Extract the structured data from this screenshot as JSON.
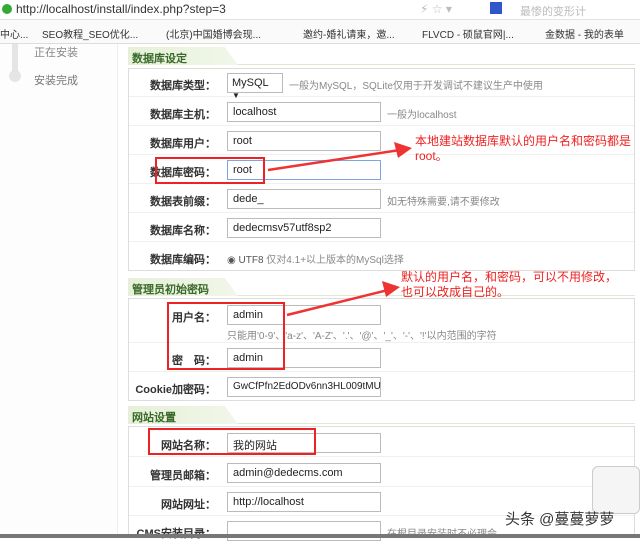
{
  "browser": {
    "url": "http://localhost/install/index.php?step=3",
    "search_placeholder": "最惨的变形计",
    "bookmarks": [
      "中心...",
      "SEO教程_SEO优化...",
      "(北京)中国婚博会现...",
      "邀约-婚礼请柬，邀...",
      "FLVCD - 硕鼠官网|...",
      "金数据 - 我的表单"
    ]
  },
  "sidebar": {
    "steps": [
      "正在安装",
      "安装完成"
    ]
  },
  "db": {
    "title": "数据库设定",
    "rows": [
      {
        "label": "数据库类型：",
        "value": "MySQL",
        "hint": "一般为MySQL，SQLite仅用于开发调试不建议生产中使用"
      },
      {
        "label": "数据库主机：",
        "value": "localhost",
        "hint": "一般为localhost"
      },
      {
        "label": "数据库用户：",
        "value": "root"
      },
      {
        "label": "数据库密码：",
        "value": "root"
      },
      {
        "label": "数据表前缀：",
        "value": "dede_",
        "hint": "如无特殊需要,请不要修改"
      },
      {
        "label": "数据库名称：",
        "value": "dedecmsv57utf8sp2"
      },
      {
        "label": "数据库编码：",
        "value": "UTF8",
        "hint": "仅对4.1+以上版本的MySql选择"
      }
    ]
  },
  "admin": {
    "title": "管理员初始密码",
    "user_label": "用户名：",
    "user_value": "admin",
    "user_hint": "只能用'0-9'、'a-z'、'A-Z'、'.'、'@'、'_'、'-'、'!'以内范围的字符",
    "pwd_label": "密　码：",
    "pwd_value": "admin",
    "cookie_label": "Cookie加密码：",
    "cookie_value": "GwCfPfn2EdODv6nn3HL009tMU"
  },
  "site": {
    "title": "网站设置",
    "rows": [
      {
        "label": "网站名称：",
        "value": "我的网站"
      },
      {
        "label": "管理员邮箱：",
        "value": "admin@dedecms.com"
      },
      {
        "label": "网站网址：",
        "value": "http://localhost"
      },
      {
        "label": "CMS安装目录：",
        "value": "",
        "hint": "在根目录安装时不必理会"
      }
    ]
  },
  "annotations": {
    "note1_line1": "本地建站数据库默认的用户名和密码都是",
    "note1_line2": "root。",
    "note2_line1": "默认的用户名，和密码，可以不用修改，",
    "note2_line2": "也可以改成自己的。"
  },
  "watermark": "头条 @蔓蔓萝萝"
}
